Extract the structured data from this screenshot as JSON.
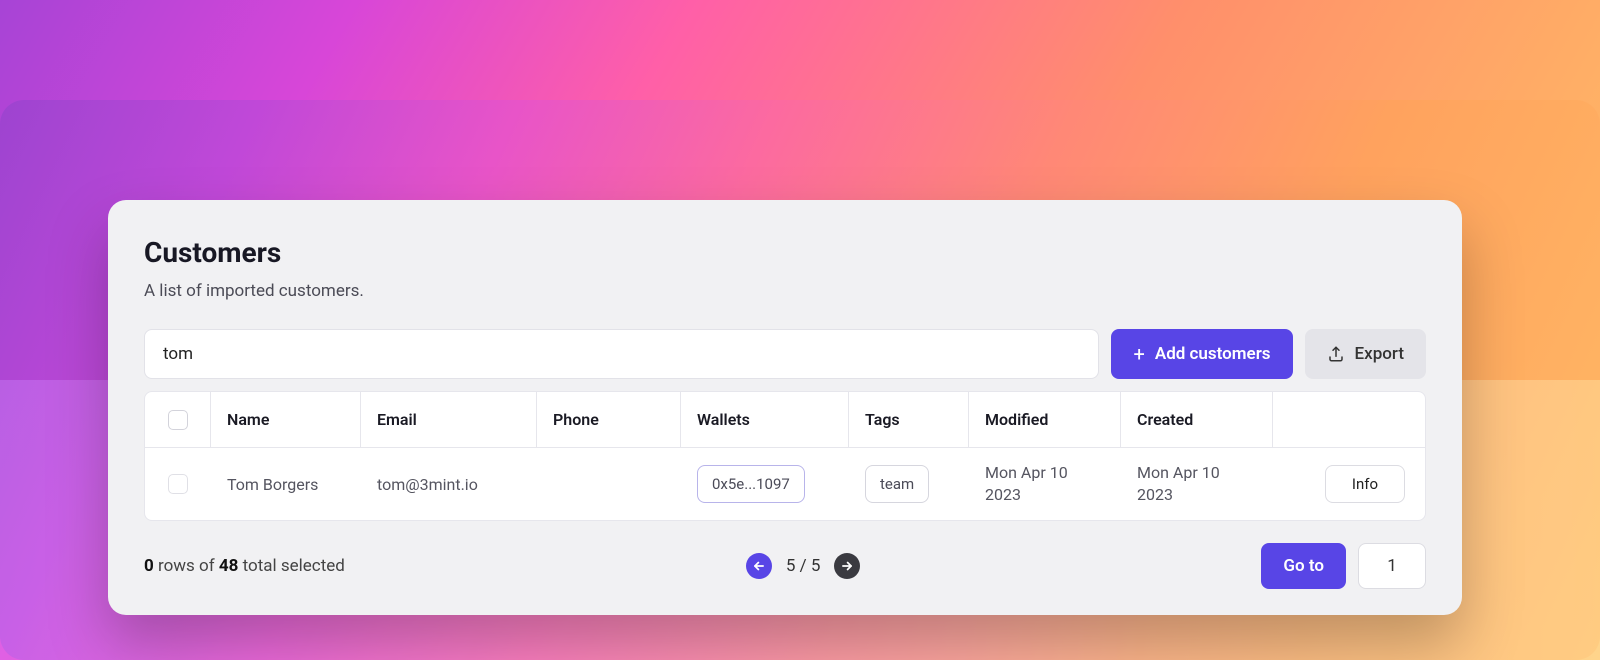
{
  "header": {
    "title": "Customers",
    "subtitle": "A list of imported customers."
  },
  "toolbar": {
    "search_value": "tom",
    "add_label": "Add customers",
    "export_label": "Export"
  },
  "table": {
    "columns": {
      "name": "Name",
      "email": "Email",
      "phone": "Phone",
      "wallets": "Wallets",
      "tags": "Tags",
      "modified": "Modified",
      "created": "Created"
    },
    "rows": [
      {
        "name": "Tom Borgers",
        "email": "tom@3mint.io",
        "phone": "",
        "wallet": "0x5e...1097",
        "tag": "team",
        "modified": "Mon Apr 10 2023",
        "created": "Mon Apr 10 2023",
        "action_label": "Info"
      }
    ]
  },
  "footer": {
    "selected_count": "0",
    "selected_mid": " rows of ",
    "total_count": "48",
    "selected_suffix": " total selected",
    "page_text": "5 / 5",
    "goto_label": "Go to",
    "goto_value": "1"
  }
}
